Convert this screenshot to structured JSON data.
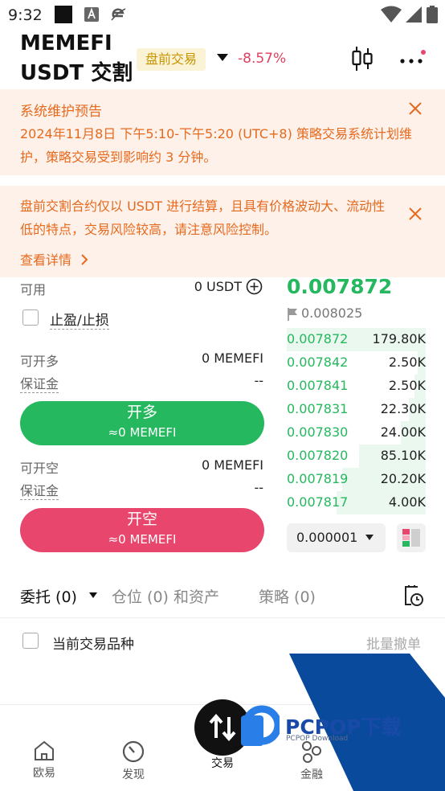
{
  "status_bar": {
    "time": "9:32"
  },
  "header": {
    "title_line1": "MEMEFI",
    "title_line2": "USDT 交割",
    "tag": "盘前交易",
    "change": "-8.57%"
  },
  "banners": {
    "maintenance": {
      "title": "系统维护预告",
      "text": "2024年11月8日 下午5:10-下午5:20 (UTC+8) 策略交易系统计划维护，策略交易受到影响约 3 分钟。"
    },
    "risk": {
      "text": "盘前交割合约仅以 USDT 进行结算，且具有价格波动大、流动性低的特点，交易风险较高，请注意风险控制。",
      "link": "查看详情"
    }
  },
  "form": {
    "available_label": "可用",
    "available_value": "0 USDT",
    "tpsl_label": "止盈/止损",
    "long": {
      "open_label": "可开多",
      "open_value": "0 MEMEFI",
      "margin_label": "保证金",
      "margin_value": "--",
      "button_label": "开多",
      "button_sub": "≈0 MEMEFI"
    },
    "short": {
      "open_label": "可开空",
      "open_value": "0 MEMEFI",
      "margin_label": "保证金",
      "margin_value": "--",
      "button_label": "开空",
      "button_sub": "≈0 MEMEFI"
    }
  },
  "orderbook": {
    "last_price": "0.007872",
    "mark_price": "0.008025",
    "rows": [
      {
        "price": "0.007872",
        "amount": "179.80K",
        "depth": 1.0
      },
      {
        "price": "0.007842",
        "amount": "2.50K",
        "depth": 0.06
      },
      {
        "price": "0.007841",
        "amount": "2.50K",
        "depth": 0.08
      },
      {
        "price": "0.007831",
        "amount": "22.30K",
        "depth": 0.12
      },
      {
        "price": "0.007830",
        "amount": "24.00K",
        "depth": 0.18
      },
      {
        "price": "0.007820",
        "amount": "85.10K",
        "depth": 0.48
      },
      {
        "price": "0.007819",
        "amount": "20.20K",
        "depth": 0.6
      },
      {
        "price": "0.007817",
        "amount": "4.00K",
        "depth": 0.64
      }
    ],
    "precision": "0.000001"
  },
  "tabs": {
    "orders": "委托 (0)",
    "positions": "仓位 (0) 和资产",
    "strategies": "策略 (0)"
  },
  "filter": {
    "current_symbol": "当前交易品种",
    "batch_cancel": "批量撤单"
  },
  "nav": [
    {
      "label": "欧易"
    },
    {
      "label": "发现"
    },
    {
      "label": "交易"
    },
    {
      "label": "金融"
    }
  ],
  "watermark": {
    "text": "PCPOP下载",
    "sub": "PCPOP Download"
  },
  "colors": {
    "green": "#25b85e",
    "red": "#e8466c",
    "orange": "#e56a1e",
    "banner_bg": "#fdf1ea",
    "tag_bg": "#fbf3d6"
  }
}
